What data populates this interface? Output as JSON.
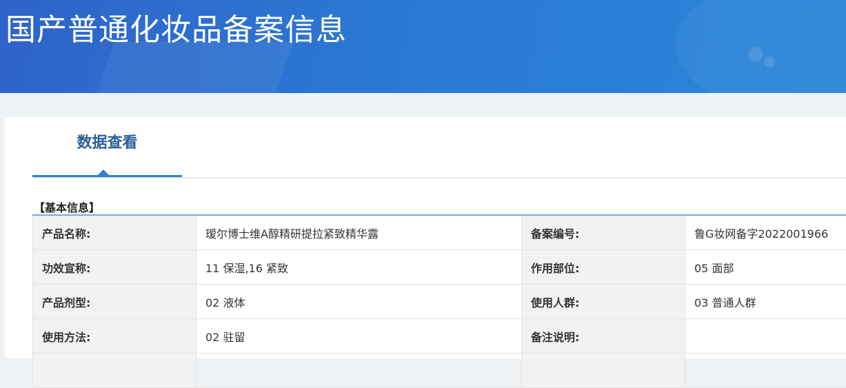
{
  "header": {
    "title": "国产普通化妆品备案信息"
  },
  "tabs": [
    {
      "label": "数据查看",
      "active": true
    }
  ],
  "section": {
    "title": "【基本信息】"
  },
  "rows": [
    {
      "label1": "产品名称:",
      "value1": "瑷尔博士维A醇精研提拉紧致精华露",
      "label2": "备案编号:",
      "value2": "鲁G妆网备字2022001966"
    },
    {
      "label1": "功效宣称:",
      "value1": "11 保湿,16 紧致",
      "label2": "作用部位:",
      "value2": "05 面部"
    },
    {
      "label1": "产品剂型:",
      "value1": "02 液体",
      "label2": "使用人群:",
      "value2": "03 普通人群"
    },
    {
      "label1": "使用方法:",
      "value1": "02 驻留",
      "label2": "备注说明:",
      "value2": ""
    }
  ],
  "colors": {
    "header": "#2b78d4",
    "tab_accent": "#2f7fd0",
    "tab_text": "#2a5d9a"
  }
}
